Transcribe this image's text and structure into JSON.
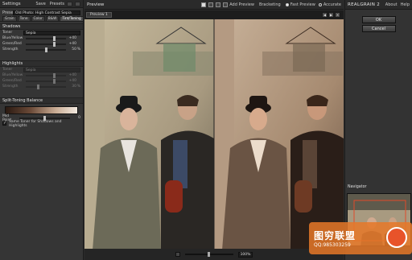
{
  "settings": {
    "title": "Settings",
    "save_label": "Save",
    "presets_label": "Presets",
    "preset_label": "Preset",
    "preset_value": "Old Photo: High Contrast Sepia",
    "tabs": [
      "Grain",
      "Tone",
      "Color",
      "B&W",
      "Tint/Toning"
    ],
    "active_tab": 4,
    "shadows": {
      "title": "Shadows",
      "toner_label": "Toner",
      "toner_value": "Sepia",
      "blue_yellow_label": "Blue/Yellow",
      "blue_yellow_value": "+40",
      "green_red_label": "Green/Red",
      "green_red_value": "+40",
      "strength_label": "Strength",
      "strength_value": "50",
      "strength_unit": "%",
      "blue_yellow_level": 0.7,
      "green_red_level": 0.7,
      "strength_level": 0.5
    },
    "highlights": {
      "title": "Highlights",
      "toner_label": "Toner",
      "toner_value": "Sepia",
      "blue_yellow_label": "Blue/Yellow",
      "blue_yellow_value": "+40",
      "green_red_label": "Green/Red",
      "green_red_value": "+40",
      "strength_label": "Strength",
      "strength_value": "30",
      "strength_unit": "%",
      "blue_yellow_level": 0.7,
      "green_red_level": 0.7,
      "strength_level": 0.3
    },
    "split": {
      "title": "Split-Toning Balance",
      "midpoint_label": "Mid Point",
      "midpoint_value": "0",
      "midpoint_level": 0.5,
      "same_toner_label": "Same Toner for Shadows and Highlights"
    }
  },
  "topbar": {
    "preview_title": "Preview",
    "add_preview_label": "Add Preview",
    "bracketing_label": "Bracketing",
    "fast_preview_label": "Fast Preview",
    "accurate_label": "Accurate",
    "brand": "REALGRAIN 2",
    "about_label": "About",
    "help_label": "Help"
  },
  "preview": {
    "tab_label": "Preview 1",
    "zoom_value": "100%",
    "zoom_level": 0.5
  },
  "right": {
    "ok_label": "OK",
    "cancel_label": "Cancel",
    "navigator_label": "Navigator"
  },
  "watermark": {
    "big": "图穷联盟",
    "small": "QQ:985303259"
  },
  "colors": {
    "panel": "#353535",
    "accent_orange": "#e8532a"
  }
}
